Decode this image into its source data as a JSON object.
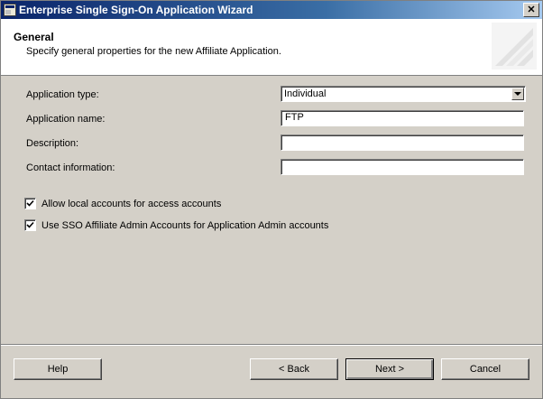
{
  "window": {
    "title": "Enterprise Single Sign-On Application Wizard",
    "close_label": "✕"
  },
  "header": {
    "title": "General",
    "subtitle": "Specify general properties for the new Affiliate Application."
  },
  "form": {
    "application_type": {
      "label": "Application type:",
      "value": "Individual"
    },
    "application_name": {
      "label": "Application name:",
      "value": "FTP"
    },
    "description": {
      "label": "Description:",
      "value": ""
    },
    "contact_information": {
      "label": "Contact information:",
      "value": ""
    }
  },
  "options": {
    "allow_local_accounts": {
      "label": "Allow local accounts for access accounts",
      "checked": true
    },
    "use_sso_affiliate_admin": {
      "label": "Use SSO Affiliate Admin Accounts for Application Admin accounts",
      "checked": true
    }
  },
  "buttons": {
    "help": "Help",
    "back": "< Back",
    "next": "Next >",
    "cancel": "Cancel"
  },
  "colors": {
    "title_bar": "#0a246a",
    "dialog_face": "#d4d0c8"
  },
  "icons": {
    "title": "wizard-window-icon",
    "close": "close-icon",
    "dropdown": "chevron-down-icon",
    "check": "checkmark-icon"
  }
}
